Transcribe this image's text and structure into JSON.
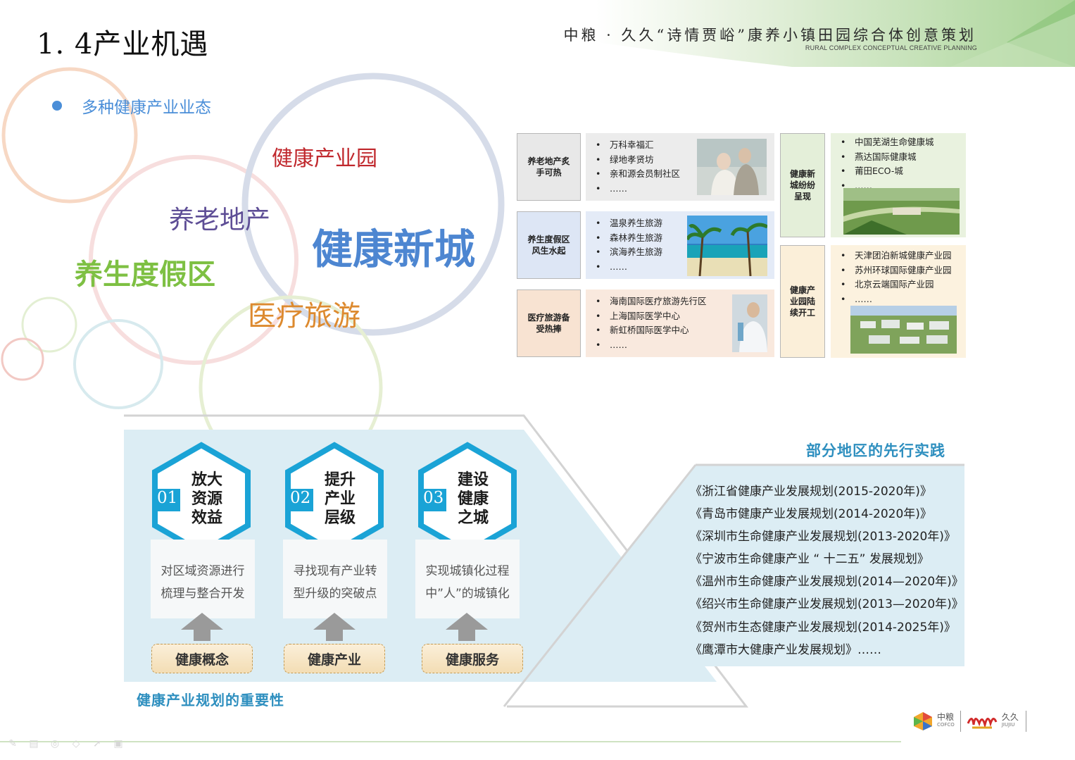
{
  "header": {
    "page_title": "1. 4产业机遇",
    "project_title": "中粮 · 久久“诗情贾峪”康养小镇田园综合体创意策划",
    "project_subtitle": "RURAL COMPLEX CONCEPTUAL CREATIVE PLANNING"
  },
  "bullet": {
    "text": "多种健康产业业态"
  },
  "word_cloud": [
    {
      "text": "健康产业园",
      "color": "#c0282d"
    },
    {
      "text": "养老地产",
      "color": "#5e4e96"
    },
    {
      "text": "健康新城",
      "color": "#4d86d1"
    },
    {
      "text": "养生度假区",
      "color": "#7ec043"
    },
    {
      "text": "医疗旅游",
      "color": "#dd8a2f"
    }
  ],
  "table": {
    "rows": [
      {
        "label": "养老地产炙手可热",
        "color": "#e8e8e8",
        "panel_color": "#ececec",
        "items": [
          "万科幸福汇",
          "绿地孝贤坊",
          "亲和源会员制社区",
          "……"
        ],
        "photo_icon": "elderly-couple-photo"
      },
      {
        "label": "养生度假区风生水起",
        "color": "#dde6f5",
        "panel_color": "#e4ebf7",
        "items": [
          "温泉养生旅游",
          "森林养生旅游",
          "滨海养生旅游",
          "……"
        ],
        "photo_icon": "seaside-resort-photo"
      },
      {
        "label": "医疗旅游备受热捧",
        "color": "#f8e3d2",
        "panel_color": "#f9e9de",
        "items": [
          "海南国际医疗旅游先行区",
          "上海国际医学中心",
          "新虹桥国际医学中心",
          "……"
        ],
        "photo_icon": "doctor-lab-photo"
      },
      {
        "label": "健康新城纷纷呈现",
        "color": "#e4efd9",
        "panel_color": "#e9f2df",
        "items": [
          "中国芜湖生命健康城",
          "燕达国际健康城",
          "莆田ECO-城",
          "……"
        ],
        "photo_icon": "new-town-aerial-photo"
      },
      {
        "label": "健康产业园陆续开工",
        "color": "#fbefd9",
        "panel_color": "#fcf2df",
        "items": [
          "天津团泊新城健康产业园",
          "苏州环球国际健康产业园",
          "北京云端国际产业园",
          "……"
        ],
        "photo_icon": "industrial-park-aerial-photo"
      }
    ]
  },
  "importance": {
    "caption": "健康产业规划的重要性",
    "steps": [
      {
        "num": "01",
        "title": [
          "放大",
          "资源",
          "效益"
        ],
        "desc": [
          "对区域资源进行",
          "梳理与整合开发"
        ],
        "base": "健康概念"
      },
      {
        "num": "02",
        "title": [
          "提升",
          "产业",
          "层级"
        ],
        "desc": [
          "寻找现有产业转",
          "型升级的突破点"
        ],
        "base": "健康产业"
      },
      {
        "num": "03",
        "title": [
          "建设",
          "健康",
          "之城"
        ],
        "desc": [
          "实现城镇化过程",
          "中”人”的城镇化"
        ],
        "base": "健康服务"
      }
    ]
  },
  "practice": {
    "caption": "部分地区的先行实践",
    "plans": [
      "《浙江省健康产业发展规划(2015-2020年)》",
      "《青岛市健康产业发展规划(2014-2020年)》",
      "《深圳市生命健康产业发展规划(2013-2020年)》",
      "《宁波市生命健康产业 “ 十二五” 发展规划》",
      "《温州市生命健康产业发展规划(2014—2020年)》",
      "《绍兴市生命健康产业发展规划(2013—2020年)》",
      "《贺州市生态健康产业发展规划(2014-2025年)》",
      "《鹰潭市大健康产业发展规划》……"
    ]
  },
  "logos": {
    "cofco_cn": "中粮",
    "cofco_en": "COFCO",
    "jiujiu_cn": "久久",
    "jiujiu_en": "JIUJIU"
  },
  "colors": {
    "accent_blue": "#2e8fbf",
    "hex_blue": "#1aa3d6",
    "header_green": "#9cc98a"
  }
}
